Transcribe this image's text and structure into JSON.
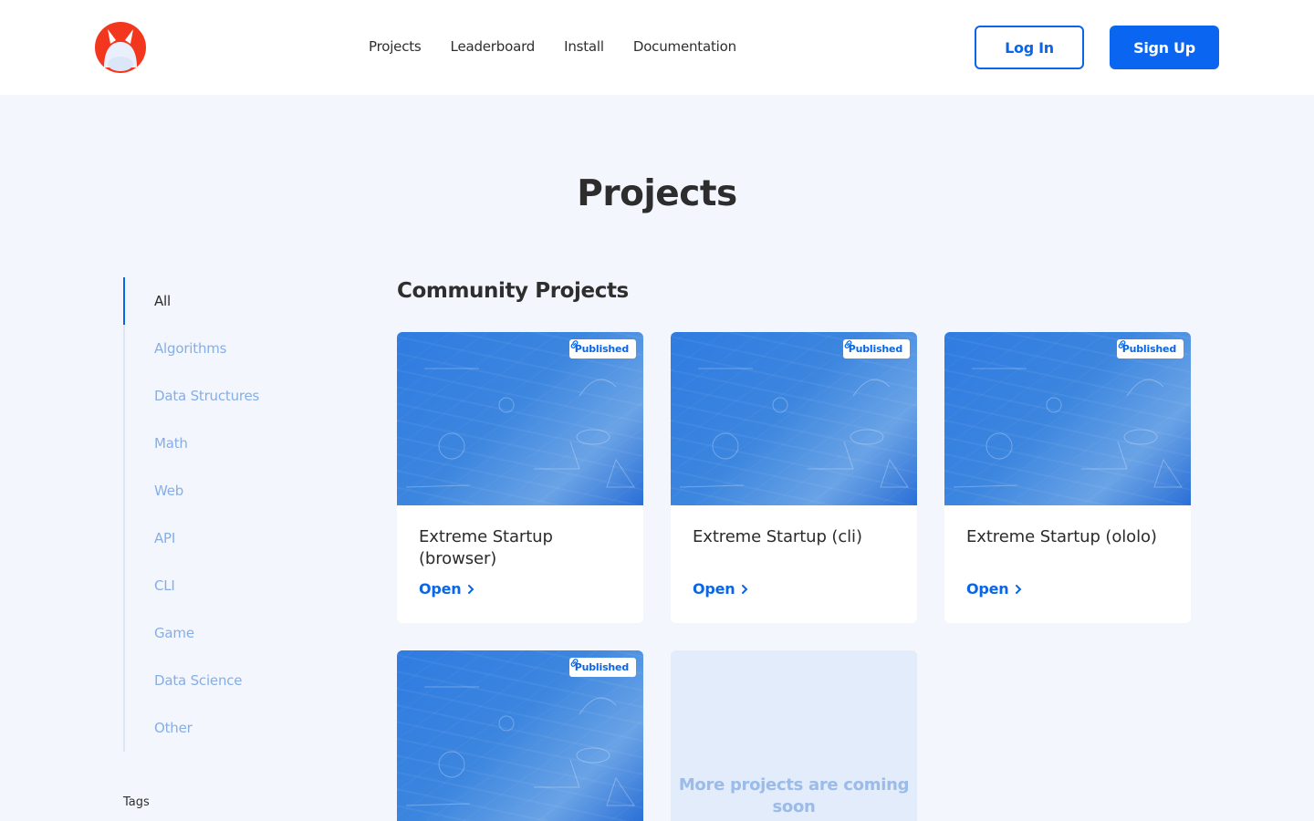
{
  "brand": {
    "accent": "#0a66e6",
    "logo_color": "#f3371e"
  },
  "nav": {
    "items": [
      "Projects",
      "Leaderboard",
      "Install",
      "Documentation"
    ],
    "login_label": "Log In",
    "signup_label": "Sign Up"
  },
  "page": {
    "title": "Projects"
  },
  "sidebar": {
    "items": [
      {
        "label": "All",
        "active": true
      },
      {
        "label": "Algorithms"
      },
      {
        "label": "Data Structures"
      },
      {
        "label": "Math"
      },
      {
        "label": "Web"
      },
      {
        "label": "API"
      },
      {
        "label": "CLI"
      },
      {
        "label": "Game"
      },
      {
        "label": "Data Science"
      },
      {
        "label": "Other"
      }
    ],
    "tags_label": "Tags"
  },
  "main": {
    "section_title": "Community Projects",
    "cards": [
      {
        "title": "Extreme Startup (browser)",
        "badge": "Published",
        "open_label": "Open",
        "icon": "link-icon"
      },
      {
        "title": "Extreme Startup (cli)",
        "badge": "Published",
        "open_label": "Open",
        "icon": "link-icon"
      },
      {
        "title": "Extreme Startup (ololo)",
        "badge": "Published",
        "open_label": "Open",
        "icon": "link-icon"
      },
      {
        "title": "",
        "badge": "Published",
        "open_label": "",
        "icon": "link-icon"
      }
    ],
    "coming_soon": "More projects are coming soon"
  }
}
